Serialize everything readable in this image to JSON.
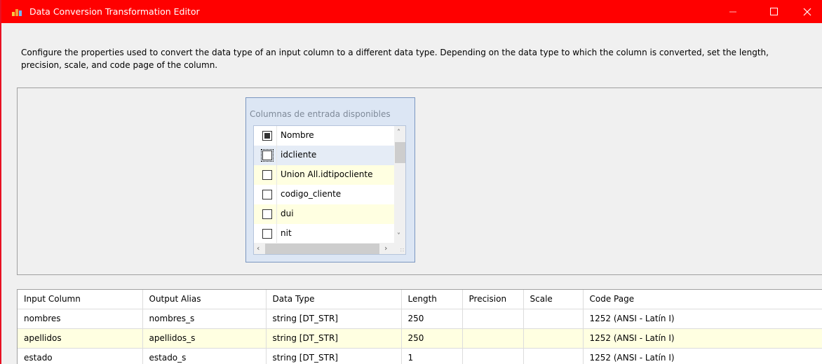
{
  "window": {
    "title": "Data Conversion Transformation Editor"
  },
  "description": "Configure the properties used to convert the data type of an input column to a different data type. Depending on the data type to which the column is converted, set the length, precision, scale, and code page of the column.",
  "available_columns": {
    "title": "Columnas de entrada disponibles",
    "header_label": "Nombre",
    "items": [
      {
        "label": "idcliente",
        "checked": false
      },
      {
        "label": "Union All.idtipocliente",
        "checked": false
      },
      {
        "label": "codigo_cliente",
        "checked": false
      },
      {
        "label": "dui",
        "checked": false
      },
      {
        "label": "nit",
        "checked": false
      }
    ]
  },
  "grid": {
    "headers": [
      "Input Column",
      "Output Alias",
      "Data Type",
      "Length",
      "Precision",
      "Scale",
      "Code Page"
    ],
    "rows": [
      [
        "nombres",
        "nombres_s",
        "string [DT_STR]",
        "250",
        "",
        "",
        "1252  (ANSI - Latín I)"
      ],
      [
        "apellidos",
        "apellidos_s",
        "string [DT_STR]",
        "250",
        "",
        "",
        "1252  (ANSI - Latín I)"
      ],
      [
        "estado",
        "estado_s",
        "string [DT_STR]",
        "1",
        "",
        "",
        "1252  (ANSI - Latín I)"
      ]
    ]
  },
  "colors": {
    "titlebar": "#ff0000",
    "row_highlight": "#ffffe1",
    "list_box_bg": "#dce6f4"
  }
}
